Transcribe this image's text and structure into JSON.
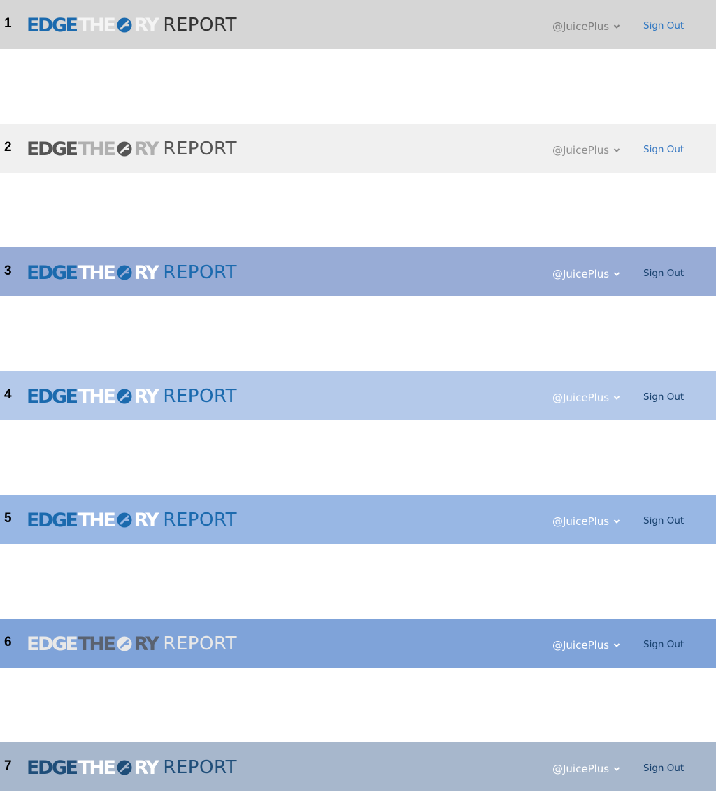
{
  "logo": {
    "part1": "EDGE",
    "part2": "THE",
    "part3": "RY",
    "part4": "REPORT"
  },
  "user": {
    "handle": "@JuicePlus",
    "signout": "Sign Out"
  },
  "variants": [
    {
      "num": "1",
      "bg": "#d6d6d6",
      "edge": "#1b6aae",
      "theo": "#f4f4f4",
      "o": "#1b6aae",
      "ry": "#f4f4f4",
      "report": "#333333",
      "user": "#7f7f7f",
      "signout": "#2f77c2"
    },
    {
      "num": "2",
      "bg": "#f0f0f0",
      "edge": "#555555",
      "theo": "#b0b0b0",
      "o": "#555555",
      "ry": "#b0b0b0",
      "report": "#555555",
      "user": "#8e8e8e",
      "signout": "#3b7ac2"
    },
    {
      "num": "3",
      "bg": "#98acd6",
      "edge": "#1b6aae",
      "theo": "#ffffff",
      "o": "#1b6aae",
      "ry": "#ffffff",
      "report": "#1b6aae",
      "user": "#ffffff",
      "signout": "#17406d"
    },
    {
      "num": "4",
      "bg": "#b4c9ea",
      "edge": "#1b6aae",
      "theo": "#ffffff",
      "o": "#1b6aae",
      "ry": "#ffffff",
      "report": "#1b6aae",
      "user": "#ffffff",
      "signout": "#17406d"
    },
    {
      "num": "5",
      "bg": "#98b7e4",
      "edge": "#1b6aae",
      "theo": "#ffffff",
      "o": "#1b6aae",
      "ry": "#ffffff",
      "report": "#1b6aae",
      "user": "#ffffff",
      "signout": "#17406d"
    },
    {
      "num": "6",
      "bg": "#7fa3d9",
      "edge": "#e8e8e8",
      "theo": "#5a6270",
      "o": "#e8e8e8",
      "ry": "#5a6270",
      "report": "#e8e8e8",
      "user": "#ffffff",
      "signout": "#17406d"
    },
    {
      "num": "7",
      "bg": "#a7b7cc",
      "edge": "#1f4e79",
      "theo": "#ffffff",
      "o": "#1f4e79",
      "ry": "#ffffff",
      "report": "#1f4e79",
      "user": "#ffffff",
      "signout": "#17406d"
    }
  ]
}
